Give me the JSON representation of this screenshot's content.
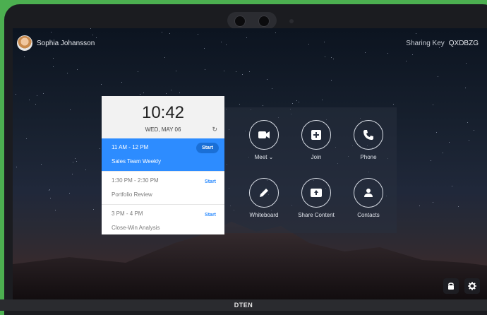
{
  "user": {
    "name": "Sophia Johansson"
  },
  "sharing": {
    "label": "Sharing Key",
    "key": "QXDBZG"
  },
  "calendar": {
    "time": "10:42",
    "date": "WED, MAY 06",
    "meetings": [
      {
        "time": "11 AM - 12 PM",
        "title": "Sales Team Weekly",
        "action": "Start",
        "active": true
      },
      {
        "time": "1:30 PM - 2:30 PM",
        "title": "Portfolio Review",
        "action": "Start",
        "active": false
      },
      {
        "time": "3 PM - 4 PM",
        "title": "Close-Win Analysis",
        "action": "Start",
        "active": false
      }
    ]
  },
  "actions": [
    {
      "label": "Meet",
      "icon": "video-camera-icon"
    },
    {
      "label": "Join",
      "icon": "plus-icon"
    },
    {
      "label": "Phone",
      "icon": "phone-icon"
    },
    {
      "label": "Whiteboard",
      "icon": "pencil-icon"
    },
    {
      "label": "Share Content",
      "icon": "share-screen-icon"
    },
    {
      "label": "Contacts",
      "icon": "person-icon"
    }
  ],
  "brand": "DTEN",
  "colors": {
    "accent": "#2d8cff",
    "bezel": "#1b1c20",
    "frame": "#4caf50"
  }
}
